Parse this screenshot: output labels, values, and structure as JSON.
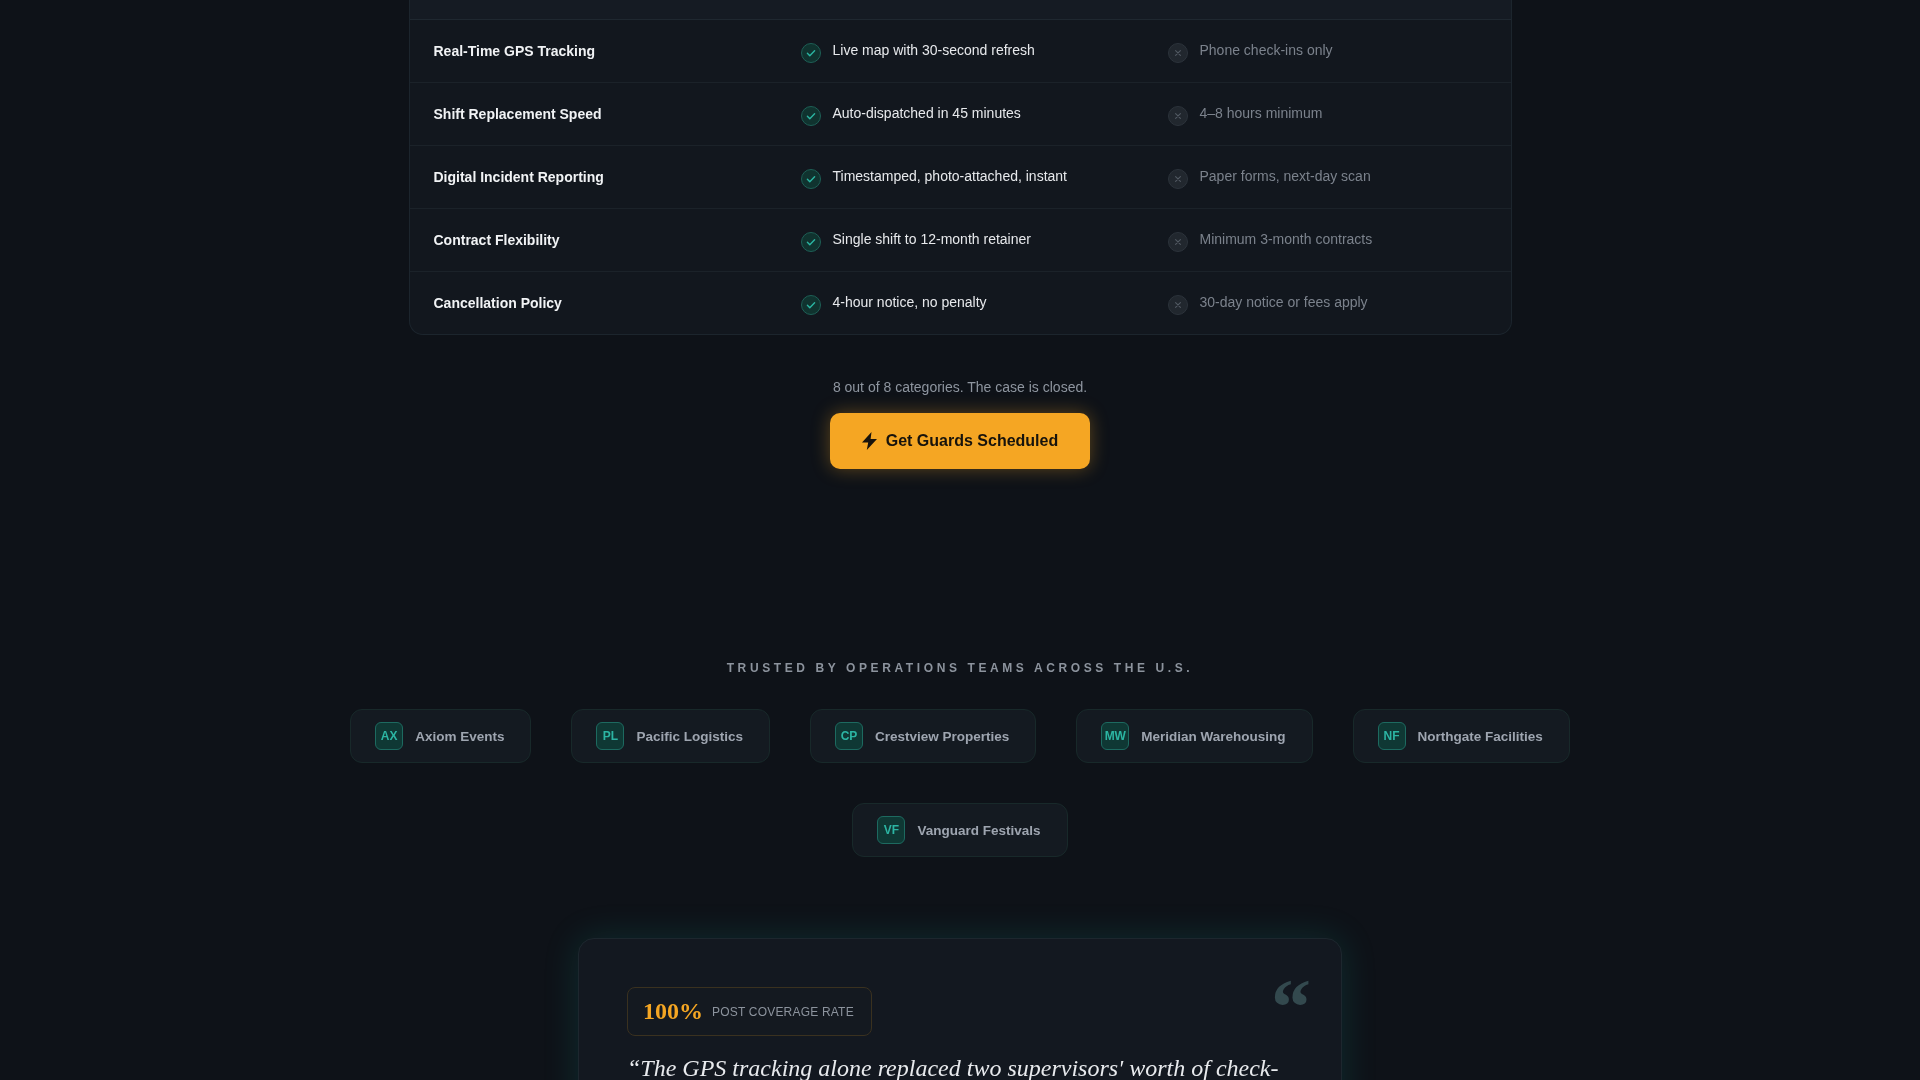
{
  "comparison": {
    "rows": [
      {
        "feature": "Real-Time GPS Tracking",
        "ours": {
          "text": "Live map with 30-second refresh",
          "included": true
        },
        "theirs": {
          "text": "Phone check-ins only",
          "included": false
        }
      },
      {
        "feature": "Shift Replacement Speed",
        "ours": {
          "text": "Auto-dispatched in 45 minutes",
          "included": true
        },
        "theirs": {
          "text": "4–8 hours minimum",
          "included": false
        }
      },
      {
        "feature": "Digital Incident Reporting",
        "ours": {
          "text": "Timestamped, photo-attached, instant",
          "included": true
        },
        "theirs": {
          "text": "Paper forms, next-day scan",
          "included": false
        }
      },
      {
        "feature": "Contract Flexibility",
        "ours": {
          "text": "Single shift to 12-month retainer",
          "included": true
        },
        "theirs": {
          "text": "Minimum 3-month contracts",
          "included": false
        }
      },
      {
        "feature": "Cancellation Policy",
        "ours": {
          "text": "4-hour notice, no penalty",
          "included": true
        },
        "theirs": {
          "text": "30-day notice or fees apply",
          "included": false
        }
      }
    ]
  },
  "summary": "8 out of 8 categories. The case is closed.",
  "cta": {
    "label": "Get Guards Scheduled"
  },
  "trusted": {
    "heading": "TRUSTED BY OPERATIONS TEAMS ACROSS THE U.S.",
    "clients": [
      {
        "initials": "AX",
        "name": "Axiom Events"
      },
      {
        "initials": "PL",
        "name": "Pacific Logistics"
      },
      {
        "initials": "CP",
        "name": "Crestview Properties"
      },
      {
        "initials": "MW",
        "name": "Meridian Warehousing"
      },
      {
        "initials": "NF",
        "name": "Northgate Facilities"
      },
      {
        "initials": "VF",
        "name": "Vanguard Festivals"
      }
    ]
  },
  "testimonial": {
    "stat": {
      "value": "100%",
      "label": "POST COVERAGE RATE"
    },
    "quote_mark": "“",
    "quote": "“The GPS tracking alone replaced two supervisors' worth of check-"
  }
}
